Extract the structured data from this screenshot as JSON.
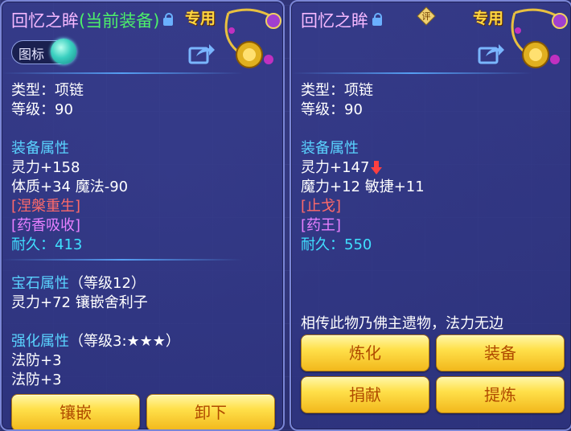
{
  "left": {
    "title_name": "回忆之眸",
    "title_current": "(当前装备)",
    "special_label": "专用",
    "toggle_label": "图标",
    "type_line": "类型：项链",
    "level_line": "等级：90",
    "equip_attr_header": "装备属性",
    "attr_line1": "灵力+158",
    "attr_line2": "体质+34 魔法-90",
    "effect1": "[涅槃重生]",
    "effect2": "[药香吸收]",
    "durability": "耐久：413",
    "gem_header": "宝石属性",
    "gem_level": "（等级12）",
    "gem_line": "灵力+72 镶嵌舍利子",
    "enhance_header": "强化属性",
    "enhance_level": "（等级3:★★★）",
    "enhance_line1": "法防+3",
    "enhance_line2": "法防+3",
    "button_inlay": "镶嵌",
    "button_unequip": "卸下"
  },
  "right": {
    "title_name": "回忆之眸",
    "review_badge": "评",
    "special_label": "专用",
    "type_line": "类型：项链",
    "level_line": "等级：90",
    "equip_attr_header": "装备属性",
    "attr_line1": "灵力+147",
    "attr_line2": "魔力+12 敏捷+11",
    "effect1": "[止戈]",
    "effect2": "[药王]",
    "durability": "耐久：550",
    "description": "相传此物乃佛主遗物，法力无边",
    "button_refine": "炼化",
    "button_equip": "装备",
    "button_donate": "捐献",
    "button_extract": "提炼"
  },
  "colors": {
    "title": "#f5b8ff",
    "current": "#4cf06a",
    "section": "#5ad3ff",
    "red_effect": "#ff6a6a",
    "purple_effect": "#e880ff",
    "durability": "#40e0ff",
    "button": "#ffe04a",
    "button_text": "#b04a00"
  },
  "icons": [
    "lock-icon",
    "share-icon",
    "necklace-icon",
    "review-badge-icon",
    "down-arrow-icon"
  ]
}
